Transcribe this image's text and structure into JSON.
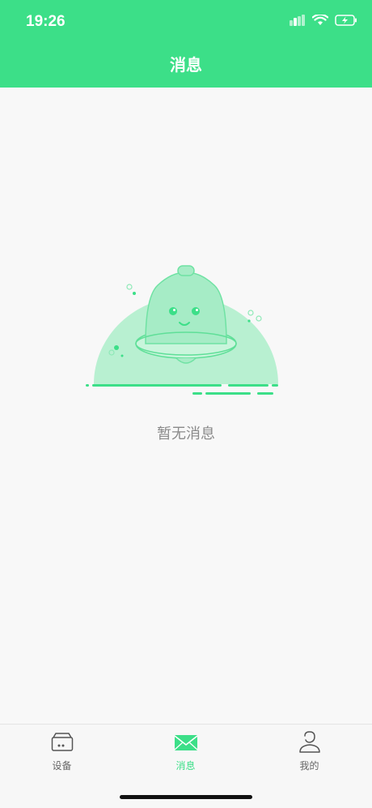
{
  "status_bar": {
    "time": "19:26"
  },
  "nav": {
    "title": "消息"
  },
  "empty_state": {
    "message": "暂无消息"
  },
  "tabbar": {
    "tabs": [
      {
        "label": "设备",
        "icon": "device-icon",
        "active": false
      },
      {
        "label": "消息",
        "icon": "mail-icon",
        "active": true
      },
      {
        "label": "我的",
        "icon": "person-icon",
        "active": false
      }
    ]
  },
  "colors": {
    "accent": "#3cdf88",
    "text_muted": "#8a8a8a",
    "background": "#f8f8f8"
  }
}
